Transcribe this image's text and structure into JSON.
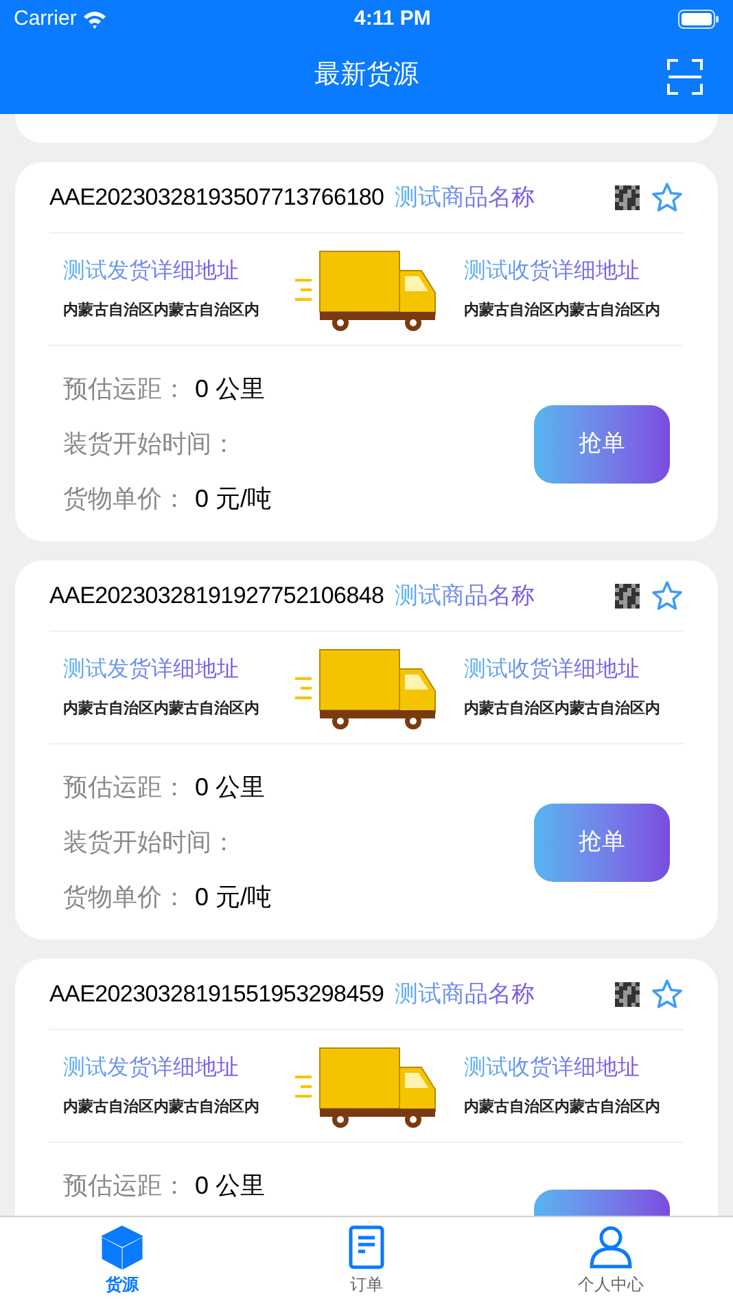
{
  "status_bar": {
    "carrier": "Carrier",
    "time": "4:11 PM"
  },
  "nav": {
    "title": "最新货源"
  },
  "cards": [
    {
      "order_no": "AAE20230328193507713766180",
      "product": "测试商品名称",
      "from_title": "测试发货详细地址",
      "from_addr": "内蒙古自治区内蒙古自治区内",
      "to_title": "测试收货详细地址",
      "to_addr": "内蒙古自治区内蒙古自治区内",
      "fields": [
        {
          "label": "预估运距：",
          "value": "0 公里"
        },
        {
          "label": "装货开始时间："
        },
        {
          "label": "货物单价：",
          "value": "0 元/吨"
        }
      ],
      "button": "抢单"
    },
    {
      "order_no": "AAE20230328191927752106848",
      "product": "测试商品名称",
      "from_title": "测试发货详细地址",
      "from_addr": "内蒙古自治区内蒙古自治区内",
      "to_title": "测试收货详细地址",
      "to_addr": "内蒙古自治区内蒙古自治区内",
      "fields": [
        {
          "label": "预估运距：",
          "value": "0 公里"
        },
        {
          "label": "装货开始时间："
        },
        {
          "label": "货物单价：",
          "value": "0 元/吨"
        }
      ],
      "button": "抢单"
    },
    {
      "order_no": "AAE20230328191551953298459",
      "product": "测试商品名称",
      "from_title": "测试发货详细地址",
      "from_addr": "内蒙古自治区内蒙古自治区内",
      "to_title": "测试收货详细地址",
      "to_addr": "内蒙古自治区内蒙古自治区内",
      "fields": [
        {
          "label": "预估运距：",
          "value": "0 公里"
        }
      ]
    }
  ],
  "tabs": [
    {
      "label": "货源",
      "kind": "box",
      "selected": true
    },
    {
      "label": "订单",
      "kind": "document",
      "selected": false
    },
    {
      "label": "个人中心",
      "kind": "person",
      "selected": false
    }
  ]
}
